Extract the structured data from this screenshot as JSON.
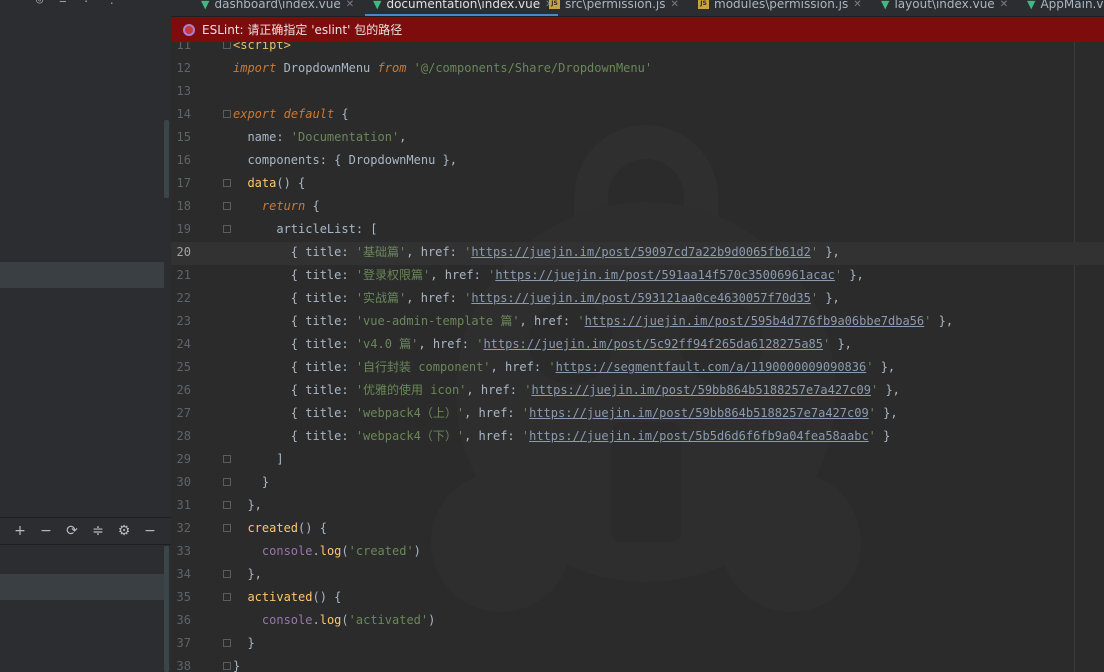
{
  "tabs": [
    {
      "label": "dashboard\\index.vue",
      "type": "vue",
      "active": false
    },
    {
      "label": "documentation\\index.vue",
      "type": "vue",
      "active": true
    },
    {
      "label": "src\\permission.js",
      "type": "js",
      "active": false
    },
    {
      "label": "modules\\permission.js",
      "type": "js",
      "active": false
    },
    {
      "label": "layout\\index.vue",
      "type": "vue",
      "active": false
    },
    {
      "label": "AppMain.v",
      "type": "vue",
      "active": false
    }
  ],
  "banner": {
    "text": "ESLint: 请正确指定 'eslint' 包的路径",
    "color": "#7d0d0d"
  },
  "editor": {
    "current_line": 20,
    "first_line": 11,
    "line_numbers": [
      "11",
      "12",
      "13",
      "14",
      "15",
      "16",
      "17",
      "18",
      "19",
      "20",
      "21",
      "22",
      "23",
      "24",
      "25",
      "26",
      "27",
      "28",
      "29",
      "30",
      "31",
      "32",
      "33",
      "34",
      "35",
      "36",
      "37",
      "38"
    ],
    "code_lines": [
      "<script>",
      "import DropdownMenu from '@/components/Share/DropdownMenu'",
      "",
      "export default {",
      "  name: 'Documentation',",
      "  components: { DropdownMenu },",
      "  data() {",
      "    return {",
      "      articleList: [",
      "        { title: '基础篇', href: 'https://juejin.im/post/59097cd7a22b9d0065fb61d2' },",
      "        { title: '登录权限篇', href: 'https://juejin.im/post/591aa14f570c35006961acac' },",
      "        { title: '实战篇', href: 'https://juejin.im/post/593121aa0ce4630057f70d35' },",
      "        { title: 'vue-admin-template 篇', href: 'https://juejin.im/post/595b4d776fb9a06bbe7dba56' },",
      "        { title: 'v4.0 篇', href: 'https://juejin.im/post/5c92ff94f265da6128275a85' },",
      "        { title: '自行封装 component', href: 'https://segmentfault.com/a/1190000009090836' },",
      "        { title: '优雅的使用 icon', href: 'https://juejin.im/post/59bb864b5188257e7a427c09' },",
      "        { title: 'webpack4（上）', href: 'https://juejin.im/post/59bb864b5188257e7a427c09' },",
      "        { title: 'webpack4（下）', href: 'https://juejin.im/post/5b5d6d6f6fb9a04fea58aabc' }",
      "      ]",
      "    }",
      "  },",
      "  created() {",
      "    console.log('created')",
      "  },",
      "  activated() {",
      "    console.log('activated')",
      "  }",
      "}"
    ]
  },
  "left_toolbar": {
    "icons": [
      "plus-icon",
      "minus-icon",
      "refresh-icon",
      "collapse-icon",
      "gear-icon",
      "hide-icon"
    ],
    "glyphs": [
      "+",
      "−",
      "⟳",
      "≑",
      "⚙",
      "−"
    ]
  },
  "colors": {
    "accent": "#4a88c7",
    "banner": "#7d0d0d",
    "editor_bg": "#2b2b2b"
  }
}
